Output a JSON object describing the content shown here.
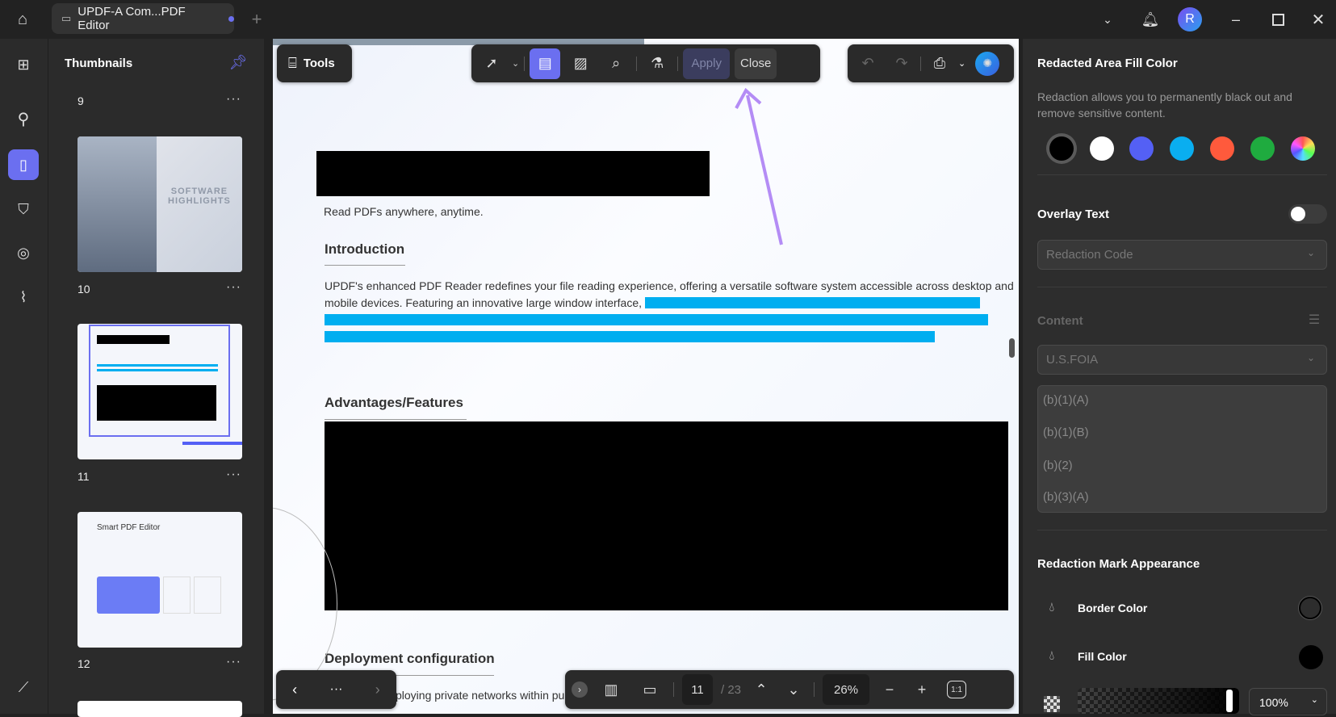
{
  "titlebar": {
    "tab_title": "UPDF-A Com...PDF Editor",
    "avatar_letter": "R"
  },
  "thumbnails": {
    "title": "Thumbnails",
    "pages": [
      {
        "label": "9"
      },
      {
        "label": "10",
        "heading": "SOFTWARE HIGHLIGHTS"
      },
      {
        "label": "11"
      },
      {
        "label": "12",
        "heading": "Smart PDF Editor"
      }
    ]
  },
  "toolbar": {
    "tools_label": "Tools",
    "apply_label": "Apply",
    "close_label": "Close"
  },
  "document": {
    "tagline": "Read PDFs anywhere, anytime.",
    "intro_heading": "Introduction",
    "intro_line1": "UPDF's enhanced PDF Reader redefines your file reading experience, offering a versatile software system accessible across desktop and",
    "intro_line2": "mobile devices. Featuring an innovative large window interface, it",
    "adv_heading": "Advantages/Features",
    "deploy_heading": "Deployment configuration",
    "deploy_text": "ploying private networks within pu"
  },
  "bottom": {
    "page_current": "11",
    "page_total": "/ 23",
    "zoom": "26%",
    "fit_label": "1:1",
    "more": "···"
  },
  "panel": {
    "fill_title": "Redacted Area Fill Color",
    "fill_desc": "Redaction allows you to permanently black out and remove sensitive content.",
    "colors": [
      "#000000",
      "#ffffff",
      "#5460f5",
      "#0aaef0",
      "#ff5a3c",
      "#1fab3f"
    ],
    "overlay_label": "Overlay Text",
    "overlay_on": false,
    "redaction_code_placeholder": "Redaction Code",
    "content_label": "Content",
    "content_select": "U.S.FOIA",
    "codes": [
      "(b)(1)(A)",
      "(b)(1)(B)",
      "(b)(2)",
      "(b)(3)(A)"
    ],
    "appearance_title": "Redaction Mark Appearance",
    "border_color_label": "Border Color",
    "fill_color_label": "Fill Color",
    "opacity": "100%"
  }
}
